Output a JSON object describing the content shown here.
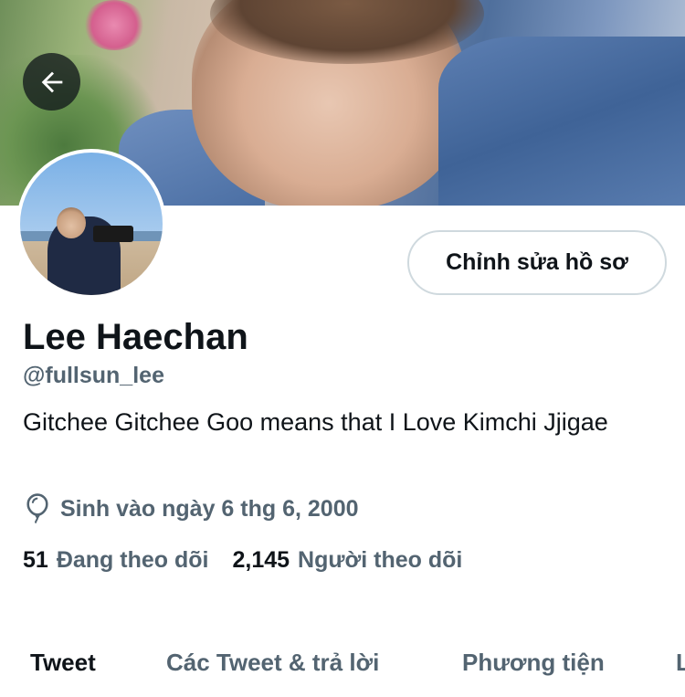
{
  "header": {
    "back_icon": "arrow-left-icon"
  },
  "profile": {
    "edit_button_label": "Chỉnh sửa hồ sơ",
    "display_name": "Lee Haechan",
    "handle": "@fullsun_lee",
    "bio": "Gitchee Gitchee Goo means that I Love Kimchi Jjigae",
    "birth_icon": "balloon-icon",
    "birthday": "Sinh vào ngày 6 thg 6, 2000",
    "following_count": "51",
    "following_label": "Đang theo dõi",
    "followers_count": "2,145",
    "followers_label": "Người theo dõi"
  },
  "tabs": [
    {
      "label": "Tweet",
      "active": true
    },
    {
      "label": "Các Tweet & trả lời",
      "active": false
    },
    {
      "label": "Phương tiện",
      "active": false
    },
    {
      "label": "L",
      "active": false
    }
  ],
  "colors": {
    "primary_text": "#0f1419",
    "secondary_text": "#536471",
    "button_border": "#cfd9de"
  }
}
